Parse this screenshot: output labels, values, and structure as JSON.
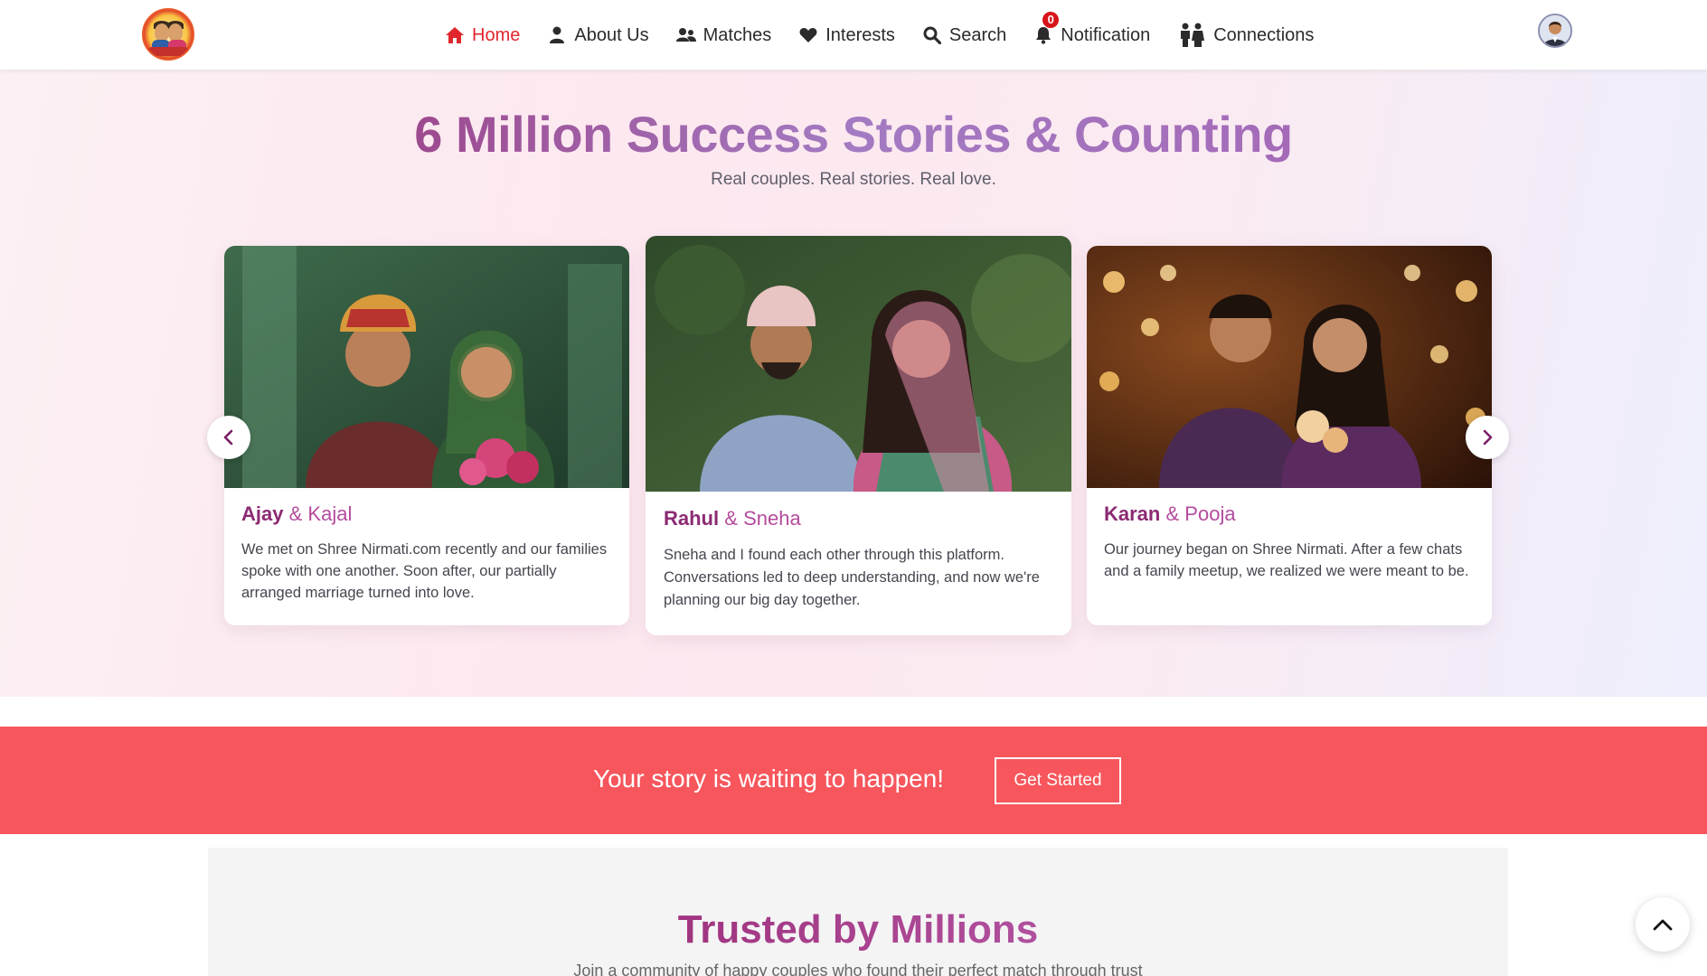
{
  "nav": {
    "items": [
      {
        "label": "Home",
        "icon": "home-icon",
        "active": true
      },
      {
        "label": "About Us",
        "icon": "user-icon"
      },
      {
        "label": "Matches",
        "icon": "users-icon"
      },
      {
        "label": "Interests",
        "icon": "heart-icon"
      },
      {
        "label": "Search",
        "icon": "search-icon"
      },
      {
        "label": "Notification",
        "icon": "bell-icon",
        "badge": "0"
      },
      {
        "label": "Connections",
        "icon": "couple-icon"
      }
    ]
  },
  "hero": {
    "title": "6 Million Success Stories & Counting",
    "subtitle": "Real couples. Real stories. Real love."
  },
  "stories": [
    {
      "name": "Ajay",
      "amp": "&",
      "partner": "Kajal",
      "text": "We met on Shree Nirmati.com recently and our families spoke with one another. Soon after, our partially arranged marriage turned into love."
    },
    {
      "name": "Rahul",
      "amp": "&",
      "partner": "Sneha",
      "text": "Sneha and I found each other through this platform. Conversations led to deep understanding, and now we're planning our big day together."
    },
    {
      "name": "Karan",
      "amp": "&",
      "partner": "Pooja",
      "text": "Our journey began on Shree Nirmati. After a few chats and a family meetup, we realized we were meant to be."
    }
  ],
  "cta": {
    "text": "Your story is waiting to happen!",
    "button": "Get Started"
  },
  "trusted": {
    "title": "Trusted by Millions",
    "subtitle": "Join a community of happy couples who found their perfect match through trust"
  },
  "colors": {
    "accent_red": "#e0262d",
    "cta_bg": "#f6565c",
    "title_purple": "#9d4a8f",
    "name_purple": "#8b2a73"
  }
}
